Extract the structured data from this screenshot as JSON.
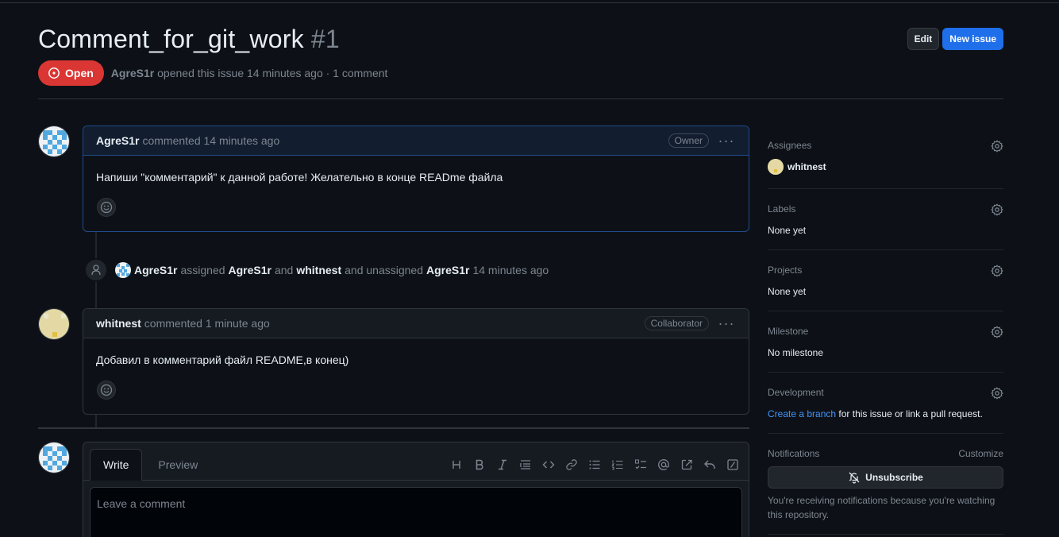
{
  "issue": {
    "title": "Comment_for_git_work",
    "number": "#1",
    "state": "Open",
    "author": "AgreS1r",
    "meta": "opened this issue 14 minutes ago · 1 comment"
  },
  "header": {
    "edit_label": "Edit",
    "new_issue_label": "New issue"
  },
  "comments": [
    {
      "author": "AgreS1r",
      "time": "commented 14 minutes ago",
      "role": "Owner",
      "body": "Напиши \"комментарий\" к данной работе! Желательно в конце READme файла"
    },
    {
      "author": "whitnest",
      "time": "commented 1 minute ago",
      "role": "Collaborator",
      "body": "Добавил в комментарий файл README,в конец)"
    }
  ],
  "event": {
    "actor": "AgreS1r",
    "w1": "assigned",
    "u1": "AgreS1r",
    "w2": "and",
    "u2": "whitnest",
    "w3": "and unassigned",
    "u3": "AgreS1r",
    "time": "14 minutes ago"
  },
  "composer": {
    "tab_write": "Write",
    "tab_preview": "Preview",
    "placeholder": "Leave a comment",
    "tools": [
      "heading-icon",
      "bold-icon",
      "italic-icon",
      "quote-icon",
      "code-icon",
      "link-icon",
      "bulleted-list-icon",
      "numbered-list-icon",
      "task-list-icon",
      "mention-icon",
      "reference-icon",
      "reply-icon",
      "slash-commands-icon"
    ]
  },
  "sidebar": {
    "assignees_title": "Assignees",
    "assignee": "whitnest",
    "labels_title": "Labels",
    "labels_value": "None yet",
    "projects_title": "Projects",
    "projects_value": "None yet",
    "milestone_title": "Milestone",
    "milestone_value": "No milestone",
    "development_title": "Development",
    "development_link": "Create a branch",
    "development_rest": " for this issue or link a pull request.",
    "notifications_title": "Notifications",
    "customize": "Customize",
    "unsubscribe": "Unsubscribe",
    "notifications_note": "You're receiving notifications because you're watching this repository."
  },
  "colors": {
    "open": "#da3633",
    "primary": "#1f6feb",
    "link": "#4493f8",
    "bg": "#0d1117"
  }
}
